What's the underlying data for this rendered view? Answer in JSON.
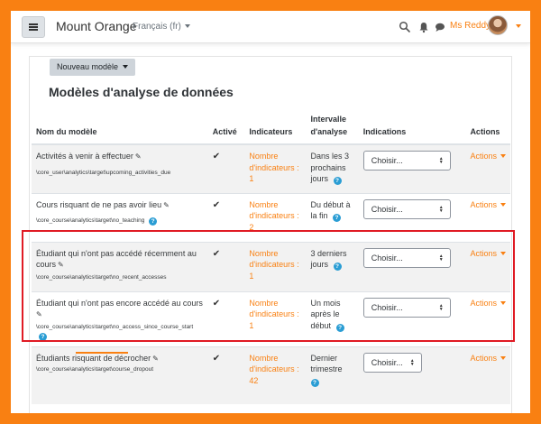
{
  "navbar": {
    "site_name": "Mount Orange",
    "language": "Français (fr)",
    "user_name": "Ms Reddy"
  },
  "toolbar": {
    "new_model_label": "Nouveau modèle"
  },
  "page_title": "Modèles d'analyse de données",
  "table": {
    "headers": {
      "name": "Nom du modèle",
      "enabled": "Activé",
      "indicators": "Indicateurs",
      "interval": "Intervalle d'analyse",
      "insights": "Indications",
      "actions": "Actions"
    },
    "rows": [
      {
        "name": "Activités à venir à effectuer",
        "target": "\\core_user\\analytics\\target\\upcoming_activities_due",
        "enabled": "✔",
        "indicators": "Nombre d'indicateurs : 1",
        "interval": "Dans les 3 prochains jours",
        "insights_select": "Choisir...",
        "actions": "Actions"
      },
      {
        "name": "Cours risquant de ne pas avoir lieu",
        "target": "\\core_course\\analytics\\target\\no_teaching",
        "enabled": "✔",
        "indicators": "Nombre d'indicateurs : 2",
        "interval": "Du début à la fin",
        "insights_select": "Choisir...",
        "actions": "Actions"
      },
      {
        "name": "Étudiant qui n'ont pas accédé récemment au cours",
        "target": "\\core_course\\analytics\\target\\no_recent_accesses",
        "enabled": "✔",
        "indicators": "Nombre d'indicateurs : 1",
        "interval": "3 derniers jours",
        "insights_select": "Choisir...",
        "actions": "Actions"
      },
      {
        "name": "Étudiant qui n'ont pas encore accédé au cours",
        "target": "\\core_course\\analytics\\target\\no_access_since_course_start",
        "enabled": "✔",
        "indicators": "Nombre d'indicateurs : 1",
        "interval": "Un mois après le début",
        "insights_select": "Choisir...",
        "actions": "Actions"
      },
      {
        "name": "Étudiants risquant de décrocher",
        "target": "\\core_course\\analytics\\target\\course_dropout",
        "enabled": "✔",
        "indicators": "Nombre d'indicateurs : 42",
        "interval": "Dernier trimestre",
        "insights_select": "Choisir...",
        "actions": "Actions"
      }
    ]
  },
  "colors": {
    "brand": "#f98012",
    "highlight": "#e01b24",
    "help": "#2a9dd4"
  }
}
